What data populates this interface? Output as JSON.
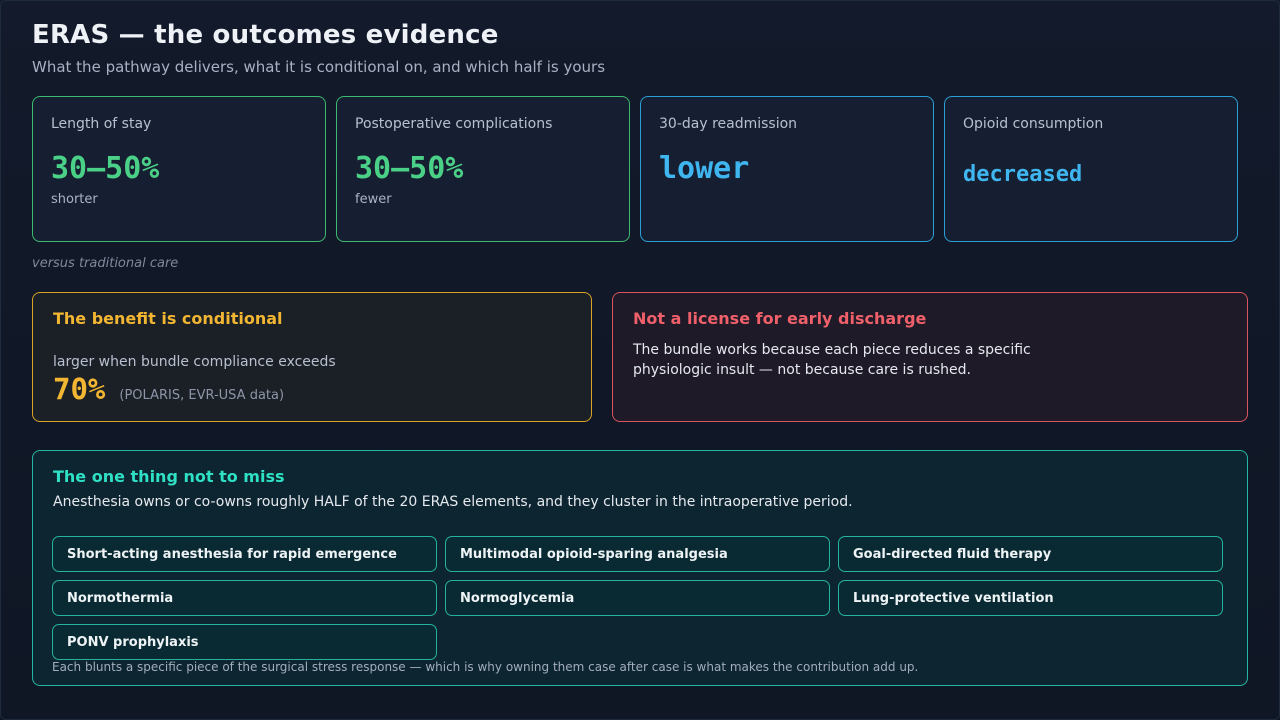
{
  "header": {
    "title": "ERAS — the outcomes evidence",
    "subtitle": "What the pathway delivers, what it is conditional on, and which half is yours"
  },
  "metrics": [
    {
      "label": "Length of stay",
      "value": "30–50%",
      "sub": "shorter",
      "color": "#4bd187"
    },
    {
      "label": "Postoperative complications",
      "value": "30–50%",
      "sub": "fewer",
      "color": "#4bd187"
    },
    {
      "label": "30-day readmission",
      "value": "lower",
      "sub": "",
      "color": "#3fb6f0"
    },
    {
      "label": "Opioid consumption",
      "value": "decreased",
      "sub": "",
      "color": "#3fb6f0"
    }
  ],
  "comparison_note": "versus traditional care",
  "conditional": {
    "heading": "The benefit is conditional",
    "lead": "larger when bundle compliance exceeds",
    "value": "70%",
    "source": "(POLARIS, EVR-USA data)",
    "color": "#f2b632"
  },
  "warning": {
    "heading": "Not a license for early discharge",
    "body": "The bundle works because each piece reduces a specific physiologic insult — not because care is rushed.",
    "color": "#f0606a"
  },
  "key_point": {
    "heading": "The one thing not to miss",
    "lead": "Anesthesia owns or co-owns roughly HALF of the 20 ERAS elements, and they cluster in the intraoperative period.",
    "elements": [
      "Short-acting anesthesia for rapid emergence",
      "Multimodal opioid-sparing analgesia",
      "Goal-directed fluid therapy",
      "Normothermia",
      "Normoglycemia",
      "Lung-protective ventilation",
      "PONV prophylaxis"
    ],
    "footnote": "Each blunts a specific piece of the surgical stress response — which is why owning them case after case is what makes the contribution add up.",
    "color": "#2ee0c4"
  }
}
